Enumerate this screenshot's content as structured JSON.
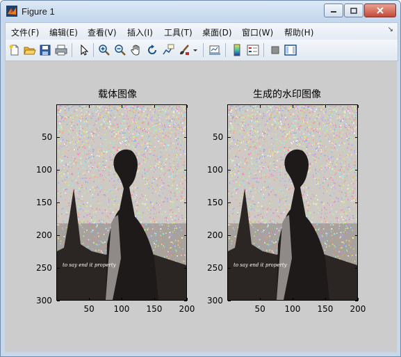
{
  "window": {
    "title": "Figure 1",
    "controls": [
      "minimize",
      "maximize",
      "close"
    ]
  },
  "menu": {
    "items": [
      {
        "label": "文件(F)"
      },
      {
        "label": "编辑(E)"
      },
      {
        "label": "查看(V)"
      },
      {
        "label": "插入(I)"
      },
      {
        "label": "工具(T)"
      },
      {
        "label": "桌面(D)"
      },
      {
        "label": "窗口(W)"
      },
      {
        "label": "帮助(H)"
      }
    ],
    "overflow_icon": "dock-arrow-icon"
  },
  "toolbar": {
    "buttons": [
      "new-figure-icon",
      "open-file-icon",
      "save-icon",
      "print-icon",
      "select-arrow-icon",
      "zoom-in-icon",
      "zoom-out-icon",
      "pan-hand-icon",
      "rotate-3d-icon",
      "data-cursor-icon",
      "brush-icon",
      "dropdown-arrow-icon",
      "link-plot-icon",
      "colorbar-icon",
      "legend-icon",
      "hide-plot-tools-icon",
      "show-plot-tools-icon"
    ]
  },
  "figure": {
    "background": "#cccccc",
    "axes": [
      {
        "title": "载体图像",
        "x_ticks": [
          "50",
          "100",
          "150",
          "200"
        ],
        "y_ticks": [
          "50",
          "100",
          "150",
          "200",
          "250",
          "300"
        ],
        "xlim": [
          0,
          200
        ],
        "ylim": [
          0,
          300
        ],
        "image_text": "to say end it property"
      },
      {
        "title": "生成的水印图像",
        "x_ticks": [
          "50",
          "100",
          "150",
          "200"
        ],
        "y_ticks": [
          "50",
          "100",
          "150",
          "200",
          "250",
          "300"
        ],
        "xlim": [
          0,
          200
        ],
        "ylim": [
          0,
          300
        ],
        "image_text": "to say end it property"
      }
    ]
  }
}
